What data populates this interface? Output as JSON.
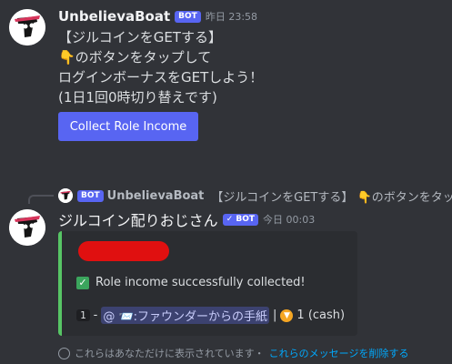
{
  "message1": {
    "author": "UnbelievaBoat",
    "badge": "BOT",
    "timestamp": "昨日 23:58",
    "lines": [
      "【ジルコインをGETする】",
      "👇のボタンをタップして",
      "ログインボーナスをGETしよう！",
      "(1日1回0時切り替えです)"
    ],
    "button_label": "Collect Role Income"
  },
  "reply_ref": {
    "badge": "BOT",
    "author": "UnbelievaBoat",
    "text": "【ジルコインをGETする】 👇のボタンをタップして"
  },
  "message2": {
    "author": "ジルコイン配りおじさん",
    "badge": "✓ BOT",
    "timestamp": "今日 00:03",
    "embed": {
      "success_text": "Role income successfully collected!",
      "index": "1",
      "separator": "-",
      "mention": "@ 📨:ファウンダーからの手紙",
      "pipe": "|",
      "amount": "1 (cash)"
    }
  },
  "ephemeral": {
    "text": "これらはあなただけに表示されています・",
    "link": "これらのメッセージを削除する"
  },
  "colors": {
    "background": "#313338",
    "blurple": "#5865f2",
    "embed_border": "#57c565",
    "link": "#00a8fc",
    "redaction": "#e01010"
  }
}
